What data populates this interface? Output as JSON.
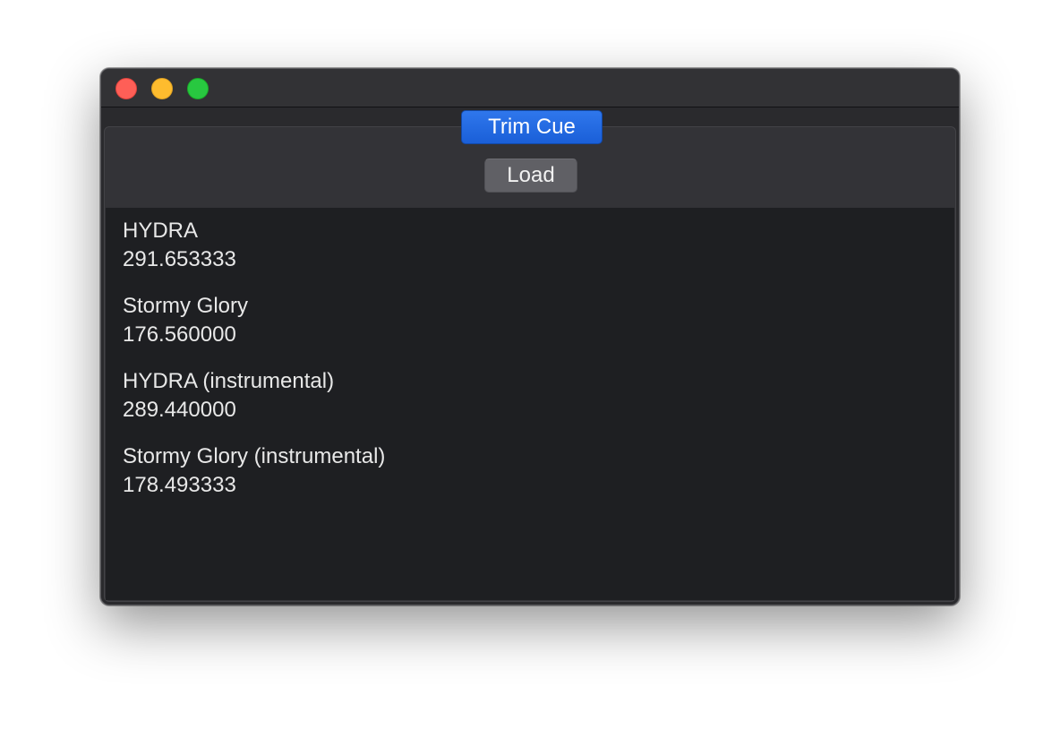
{
  "window": {
    "controls": {
      "close": "close-button",
      "minimize": "minimize-button",
      "zoom": "zoom-button"
    }
  },
  "tabs": [
    {
      "label": "Trim Cue",
      "selected": true
    }
  ],
  "toolbar": {
    "load_label": "Load"
  },
  "tracks": [
    {
      "title": "HYDRA",
      "duration": "291.653333"
    },
    {
      "title": "Stormy Glory",
      "duration": "176.560000"
    },
    {
      "title": "HYDRA (instrumental)",
      "duration": "289.440000"
    },
    {
      "title": "Stormy Glory (instrumental)",
      "duration": "178.493333"
    }
  ],
  "colors": {
    "accent": "#1a5fd8",
    "window_bg": "#2a2a2d",
    "list_bg": "#1e1f22",
    "text": "#e8e8e8"
  }
}
